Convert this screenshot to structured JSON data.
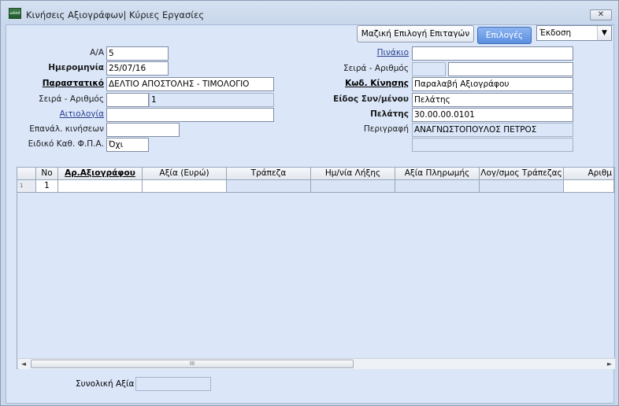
{
  "window": {
    "title": "Κινήσεις Αξιογράφων| Κύριες Εργασίες",
    "close_glyph": "✕",
    "app_icon_text": "ωbsd"
  },
  "toolbar": {
    "mass_select_label": "Μαζική Επιλογή Επιταγών",
    "options_label": "Επιλογές",
    "print_select_value": "Έκδοση"
  },
  "left_form": {
    "aa_label": "Α/Α",
    "aa_value": "5",
    "date_label": "Ημερομηνία",
    "date_value": "25/07/16",
    "doc_label": "Παραστατικό",
    "doc_value": "ΔΕΛΤΙΟ ΑΠΟΣΤΟΛΗΣ - ΤΙΜΟΛΟΓΙΟ",
    "series_label": "Σειρά - Αριθμός",
    "series_value": "",
    "number_value": "1",
    "reason_label": "Αιτιολογία",
    "reason_value": "",
    "repeat_label": "Επανάλ. κινήσεων",
    "repeat_value": "",
    "vat_label": "Ειδικό Καθ. Φ.Π.Α.",
    "vat_value": "Όχι"
  },
  "right_form": {
    "pinakio_label": "Πινάκιο",
    "pinakio_value": "",
    "series_label": "Σειρά - Αριθμός",
    "series_value": "",
    "number_value": "",
    "movement_code_label": "Κωδ. Κίνησης",
    "movement_code_value": "Παραλαβή Αξιογράφου",
    "party_type_label": "Είδος Συν/μένου",
    "party_type_value": "Πελάτης",
    "customer_label": "Πελάτης",
    "customer_value": "30.00.00.0101",
    "description_label": "Περιγραφή",
    "description_value": "ΑΝΑΓΝΩΣΤΟΠΟΥΛΟΣ ΠΕΤΡΟΣ",
    "extra_value": ""
  },
  "grid": {
    "columns": [
      "Νο",
      "Αρ.Αξιογράφου",
      "Αξία (Ευρώ)",
      "Τράπεζα",
      "Ημ/νία Λήξης",
      "Αξία Πληρωμής",
      "Λογ/σμος Τράπεζας",
      "Αριθμ"
    ],
    "row_indicator": "1",
    "rows": [
      {
        "no": "1"
      }
    ],
    "scroll_thumb_glyph": "III",
    "scroll_left_glyph": "◄",
    "scroll_right_glyph": "►"
  },
  "footer": {
    "total_label": "Συνολική Αξία",
    "total_value": ""
  }
}
